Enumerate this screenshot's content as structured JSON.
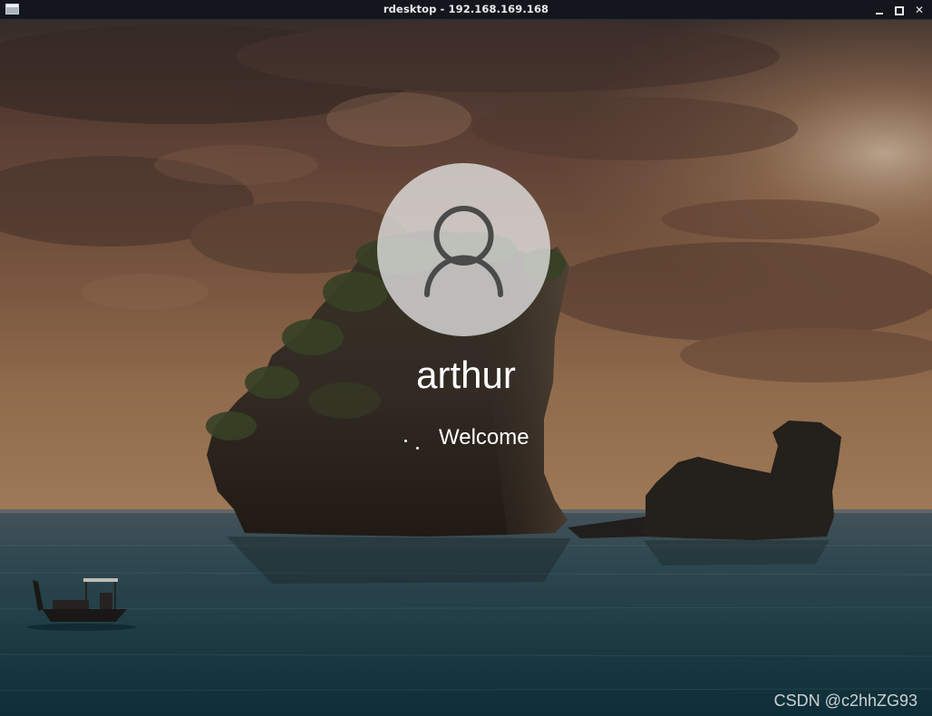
{
  "window": {
    "title": "rdesktop - 192.168.169.168",
    "icons": {
      "app": "window-app-icon",
      "minimize": "minimize-icon",
      "maximize": "maximize-icon",
      "close": "close-icon"
    },
    "close_glyph": "✕"
  },
  "lock_screen": {
    "username": "arthur",
    "status_text": "Welcome",
    "avatar_icon": "user-silhouette-icon",
    "spinner_icon": "loading-spinner-icon",
    "background": "sea-stack-sunset-wallpaper"
  },
  "watermark": "CSDN @c2hhZG93",
  "colors": {
    "titlebar_bg": "#13161c",
    "titlebar_text": "#e8eaee",
    "avatar_bg": "#e4e4e4",
    "avatar_icon": "#4a4a4a",
    "text": "#ffffff"
  }
}
